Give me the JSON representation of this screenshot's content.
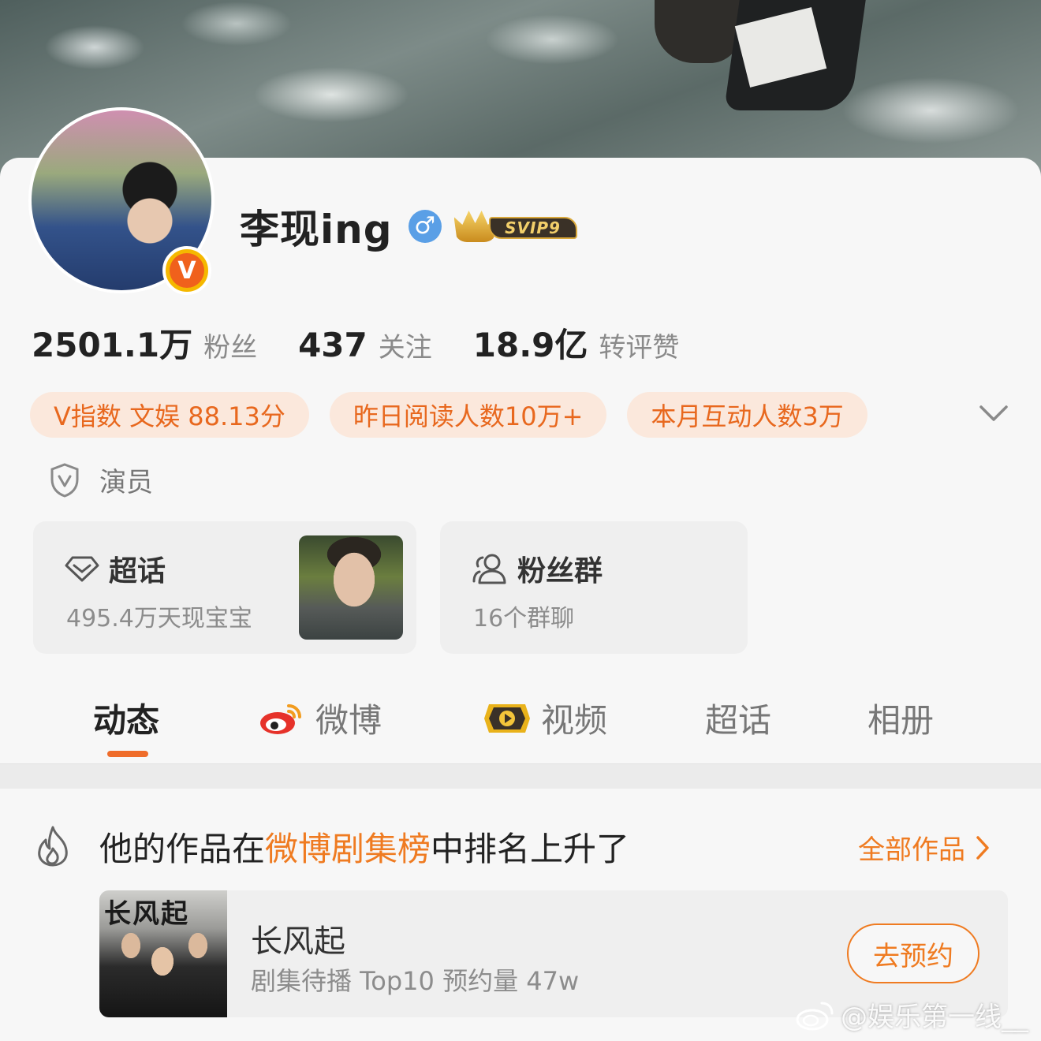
{
  "profile": {
    "name": "李现ing",
    "gender_symbol": "♂",
    "svip_label": "SVIP9",
    "verified_badge": "V"
  },
  "stats": [
    {
      "value": "2501.1万",
      "label": "粉丝"
    },
    {
      "value": "437",
      "label": "关注"
    },
    {
      "value": "18.9亿",
      "label": "转评赞"
    }
  ],
  "pills": [
    "V指数 文娱 88.13分",
    "昨日阅读人数10万+",
    "本月互动人数3万"
  ],
  "role": {
    "label": "演员",
    "icon": "shield-v-icon"
  },
  "cards": {
    "super_topic": {
      "title": "超话",
      "subtitle": "495.4万天现宝宝",
      "icon": "diamond-icon"
    },
    "fan_group": {
      "title": "粉丝群",
      "subtitle": "16个群聊",
      "icon": "people-icon"
    }
  },
  "tabs": [
    {
      "label": "动态",
      "active": true
    },
    {
      "label": "微博",
      "active": false,
      "icon": "weibo-icon"
    },
    {
      "label": "视频",
      "active": false,
      "icon": "video-play-icon"
    },
    {
      "label": "超话",
      "active": false
    },
    {
      "label": "相册",
      "active": false
    }
  ],
  "ranking": {
    "prefix": "他的作品在",
    "highlight": "微博剧集榜",
    "suffix": "中排名上升了",
    "all_works": "全部作品",
    "icon": "fire-icon"
  },
  "work": {
    "poster_text": "长风起",
    "title": "长风起",
    "subtitle": "剧集待播 Top10 预约量 47w",
    "button": "去预约"
  },
  "watermark": "@娱乐第一线__",
  "colors": {
    "accent": "#ef7b21",
    "pill_bg": "#fbe8dc",
    "tab_underline": "#ef6c2a",
    "gender_blue": "#5a9fe6"
  }
}
